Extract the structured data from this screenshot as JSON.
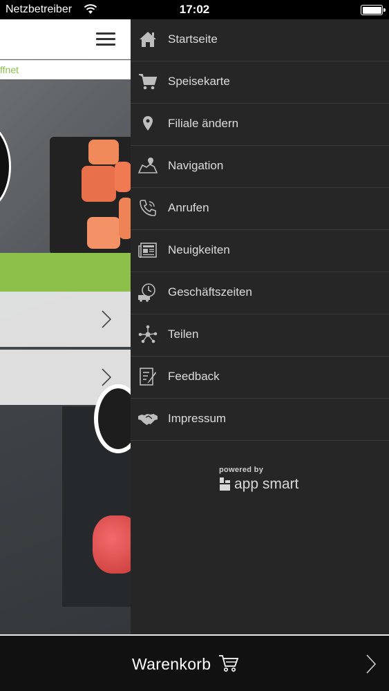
{
  "status_bar": {
    "carrier": "Netzbetreiber",
    "time": "17:02",
    "battery_level": 1.0
  },
  "main": {
    "opening_status_fragment": "ffnet"
  },
  "menu": {
    "items": [
      {
        "label": "Startseite",
        "icon": "home-icon"
      },
      {
        "label": "Speisekarte",
        "icon": "cart-icon"
      },
      {
        "label": "Filiale ändern",
        "icon": "location-pin-icon"
      },
      {
        "label": "Navigation",
        "icon": "map-icon"
      },
      {
        "label": "Anrufen",
        "icon": "phone-icon"
      },
      {
        "label": "Neuigkeiten",
        "icon": "newspaper-icon"
      },
      {
        "label": "Geschäftszeiten",
        "icon": "clock-truck-icon"
      },
      {
        "label": "Teilen",
        "icon": "share-network-icon"
      },
      {
        "label": "Feedback",
        "icon": "feedback-form-icon"
      },
      {
        "label": "Impressum",
        "icon": "handshake-icon"
      }
    ]
  },
  "powered_by": {
    "prefix": "powered by",
    "brand": "app smart"
  },
  "bottom_bar": {
    "cart_label": "Warenkorb"
  },
  "colors": {
    "accent_green": "#8cc04b",
    "drawer_bg": "#262626",
    "bottom_bar_bg": "#111111"
  }
}
